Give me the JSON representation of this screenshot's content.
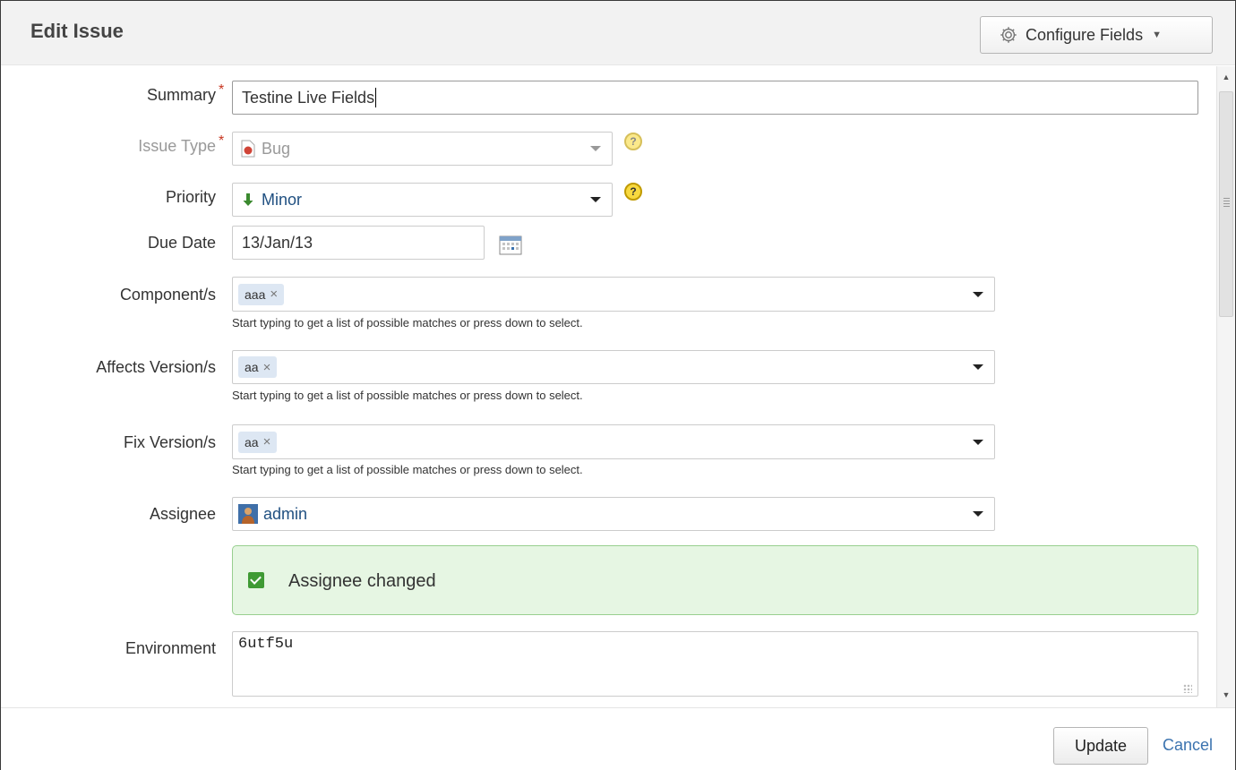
{
  "dialog": {
    "title": "Edit Issue",
    "configure_label": "Configure Fields"
  },
  "fields": {
    "summary": {
      "label": "Summary",
      "value": "Testine Live Fields"
    },
    "issue_type": {
      "label": "Issue Type",
      "value": "Bug"
    },
    "priority": {
      "label": "Priority",
      "value": "Minor"
    },
    "due_date": {
      "label": "Due Date",
      "value": "13/Jan/13"
    },
    "components": {
      "label": "Component/s",
      "chip": "aaa"
    },
    "affects_versions": {
      "label": "Affects Version/s",
      "chip": "aa"
    },
    "fix_versions": {
      "label": "Fix Version/s",
      "chip": "aa"
    },
    "assignee": {
      "label": "Assignee",
      "value": "admin"
    },
    "environment": {
      "label": "Environment",
      "value": "6utf5u"
    }
  },
  "hint": "Start typing to get a list of possible matches or press down to select.",
  "notice": "Assignee changed",
  "help_glyph": "?",
  "remove_glyph": "×",
  "required_glyph": "*",
  "footer": {
    "update_label": "Update",
    "cancel_label": "Cancel"
  },
  "icons": {
    "configure": "gear-icon",
    "issue_type": "bug-icon",
    "priority": "priority-minor-arrow-icon",
    "due_date": "calendar-icon",
    "assignee": "user-avatar-icon",
    "notice": "checkbox-check-icon"
  },
  "colors": {
    "accent_link": "#3b73af",
    "notice_bg": "#e6f6e3",
    "required": "#c7351f",
    "priority_minor": "#3b8a2f"
  }
}
